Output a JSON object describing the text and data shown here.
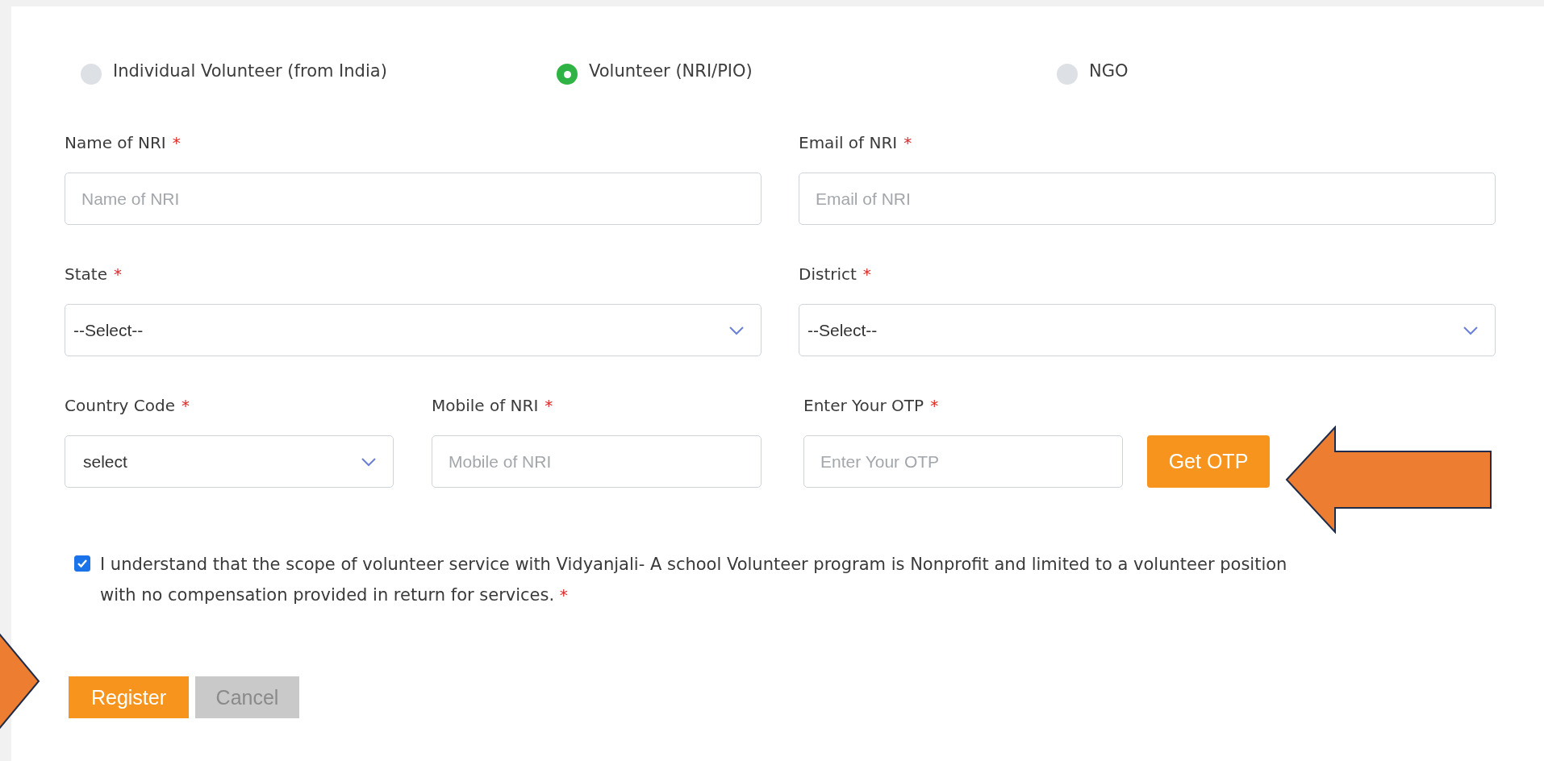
{
  "volunteer_types": [
    {
      "label": "Individual Volunteer (from India)",
      "selected": false
    },
    {
      "label": "Volunteer (NRI/PIO)",
      "selected": true
    },
    {
      "label": "NGO",
      "selected": false
    }
  ],
  "rows": [
    [
      {
        "kind": "text",
        "label": "Name of NRI",
        "required_mark": "*",
        "placeholder": "Name of NRI"
      },
      {
        "kind": "text",
        "label": "Email of NRI",
        "required_mark": "*",
        "placeholder": "Email of NRI"
      }
    ],
    [
      {
        "kind": "select",
        "label": "State",
        "required_mark": "*",
        "value": "--Select--"
      },
      {
        "kind": "select",
        "label": "District",
        "required_mark": "*",
        "value": "--Select--"
      }
    ],
    [
      {
        "kind": "select",
        "label": "Country Code",
        "required_mark": "*",
        "value": "select"
      },
      {
        "kind": "text",
        "label": "Mobile of NRI",
        "required_mark": "*",
        "placeholder": "Mobile of NRI"
      },
      {
        "kind": "otp",
        "label": "Enter Your OTP",
        "required_mark": "*",
        "placeholder": "Enter Your OTP",
        "button": "Get OTP"
      }
    ]
  ],
  "agreement": {
    "checked": true,
    "text": "I understand that the scope of volunteer service with Vidyanjali- A school Volunteer program is Nonprofit and limited to a volunteer position with no compensation provided in return for services.",
    "required_mark": "*"
  },
  "buttons": [
    {
      "kind": "primary",
      "label": "Register"
    },
    {
      "kind": "secondary",
      "label": "Cancel"
    }
  ]
}
